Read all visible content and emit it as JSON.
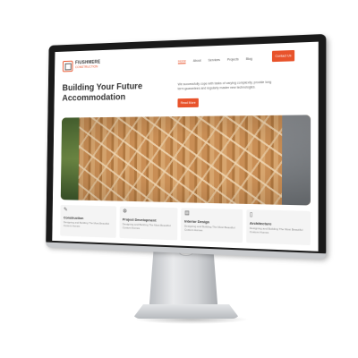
{
  "site": {
    "logo": {
      "title": "FIUSHMERE",
      "subtitle": "CONSTRUCTION"
    },
    "nav": [
      "Home",
      "About",
      "Services",
      "Projects",
      "Blog"
    ],
    "contact_label": "Contact Us",
    "hero": {
      "title_line1": "Building Your Future",
      "title_line2": "Accommodation",
      "description": "We successfully cope with tasks of varying complexity, provide long term guarantees and regularly master new technologies.",
      "button_label": "Read More"
    },
    "services": [
      {
        "icon": "✎",
        "title": "Construction",
        "desc": "Designing and Building The Most Beautiful Custom Homes"
      },
      {
        "icon": "⚙",
        "title": "Project Development",
        "desc": "Designing and Building The Most Beautiful Custom Homes"
      },
      {
        "icon": "▤",
        "title": "Interior Design",
        "desc": "Designing and Building The Most Beautiful Custom Homes"
      },
      {
        "icon": "▯",
        "title": "Architecture",
        "desc": "Designing and Building The Most Beautiful Custom Homes"
      }
    ]
  }
}
